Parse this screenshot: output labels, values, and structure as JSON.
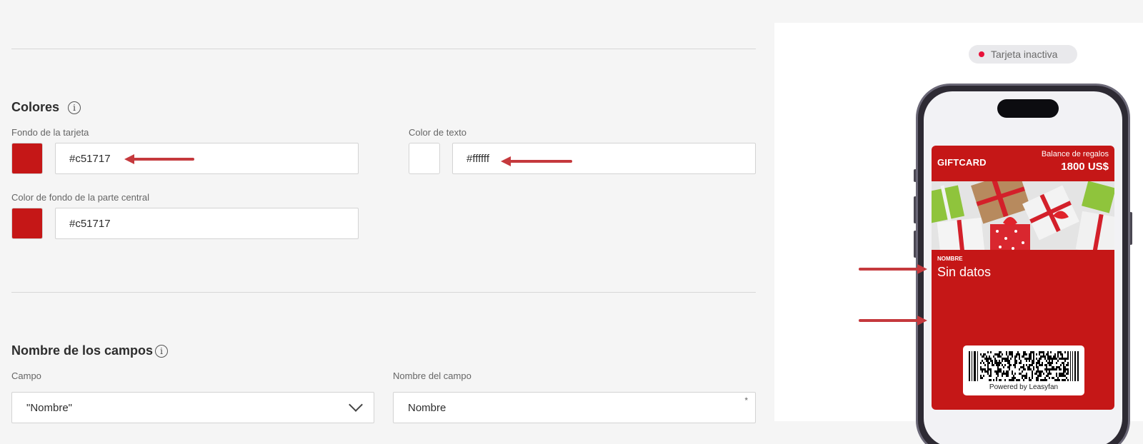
{
  "colors_section": {
    "title": "Colores",
    "card_bg": {
      "label": "Fondo de la tarjeta",
      "value": "#c51717",
      "swatch": "#c51717"
    },
    "text_color": {
      "label": "Color de texto",
      "value": "#ffffff",
      "swatch": "#ffffff"
    },
    "center_bg": {
      "label": "Color de fondo de la parte central",
      "value": "#c51717",
      "swatch": "#c51717"
    }
  },
  "fields_section": {
    "title": "Nombre de los campos",
    "field": {
      "label": "Campo",
      "value": "\"Nombre\""
    },
    "field_name": {
      "label": "Nombre del campo",
      "value": "Nombre",
      "required_mark": "*"
    }
  },
  "preview": {
    "status_text": "Tarjeta inactiva",
    "status_color": "#e8123a",
    "card": {
      "brand": "GIFTCARD",
      "balance_label": "Balance de regalos",
      "balance_value": "1800 US$",
      "field_label": "NOMBRE",
      "field_value": "Sin datos",
      "powered_by": "Powered by Leasyfan",
      "background": "#c51717",
      "image": "gift-boxes-image"
    }
  },
  "annotation_arrow_color": "#c5393d"
}
